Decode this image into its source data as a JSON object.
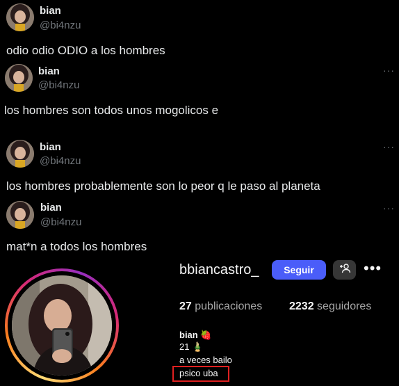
{
  "tweets": [
    {
      "name": "bian",
      "handle": "@bi4nzu",
      "text": "odio odio ODIO a los hombres"
    },
    {
      "name": "bian",
      "handle": "@bi4nzu",
      "text": "los hombres son todos unos mogolicos e"
    },
    {
      "name": "bian",
      "handle": "@bi4nzu",
      "text": "los hombres probablemente son lo peor q le paso al planeta"
    },
    {
      "name": "bian",
      "handle": "@bi4nzu",
      "text": "mat*n a todos los hombres"
    }
  ],
  "more_glyph": "···",
  "profile": {
    "username": "bbiancastro_",
    "follow_label": "Seguir",
    "more_glyph": "•••",
    "stats": {
      "posts_count": "27",
      "posts_label": "publicaciones",
      "followers_count": "2232",
      "followers_label": "seguidores"
    },
    "bio": {
      "name": "bian",
      "name_emoji": "🍓",
      "age": "21",
      "age_emoji": "🎍",
      "line3": "a veces bailo",
      "line4": "psico uba"
    }
  },
  "colors": {
    "follow_button": "#4a5df9",
    "handle_gray": "#71767b",
    "highlight_box": "#e02020"
  },
  "icons": [
    "more-icon",
    "add-friend-icon",
    "strawberry-emoji",
    "bamboo-emoji"
  ]
}
